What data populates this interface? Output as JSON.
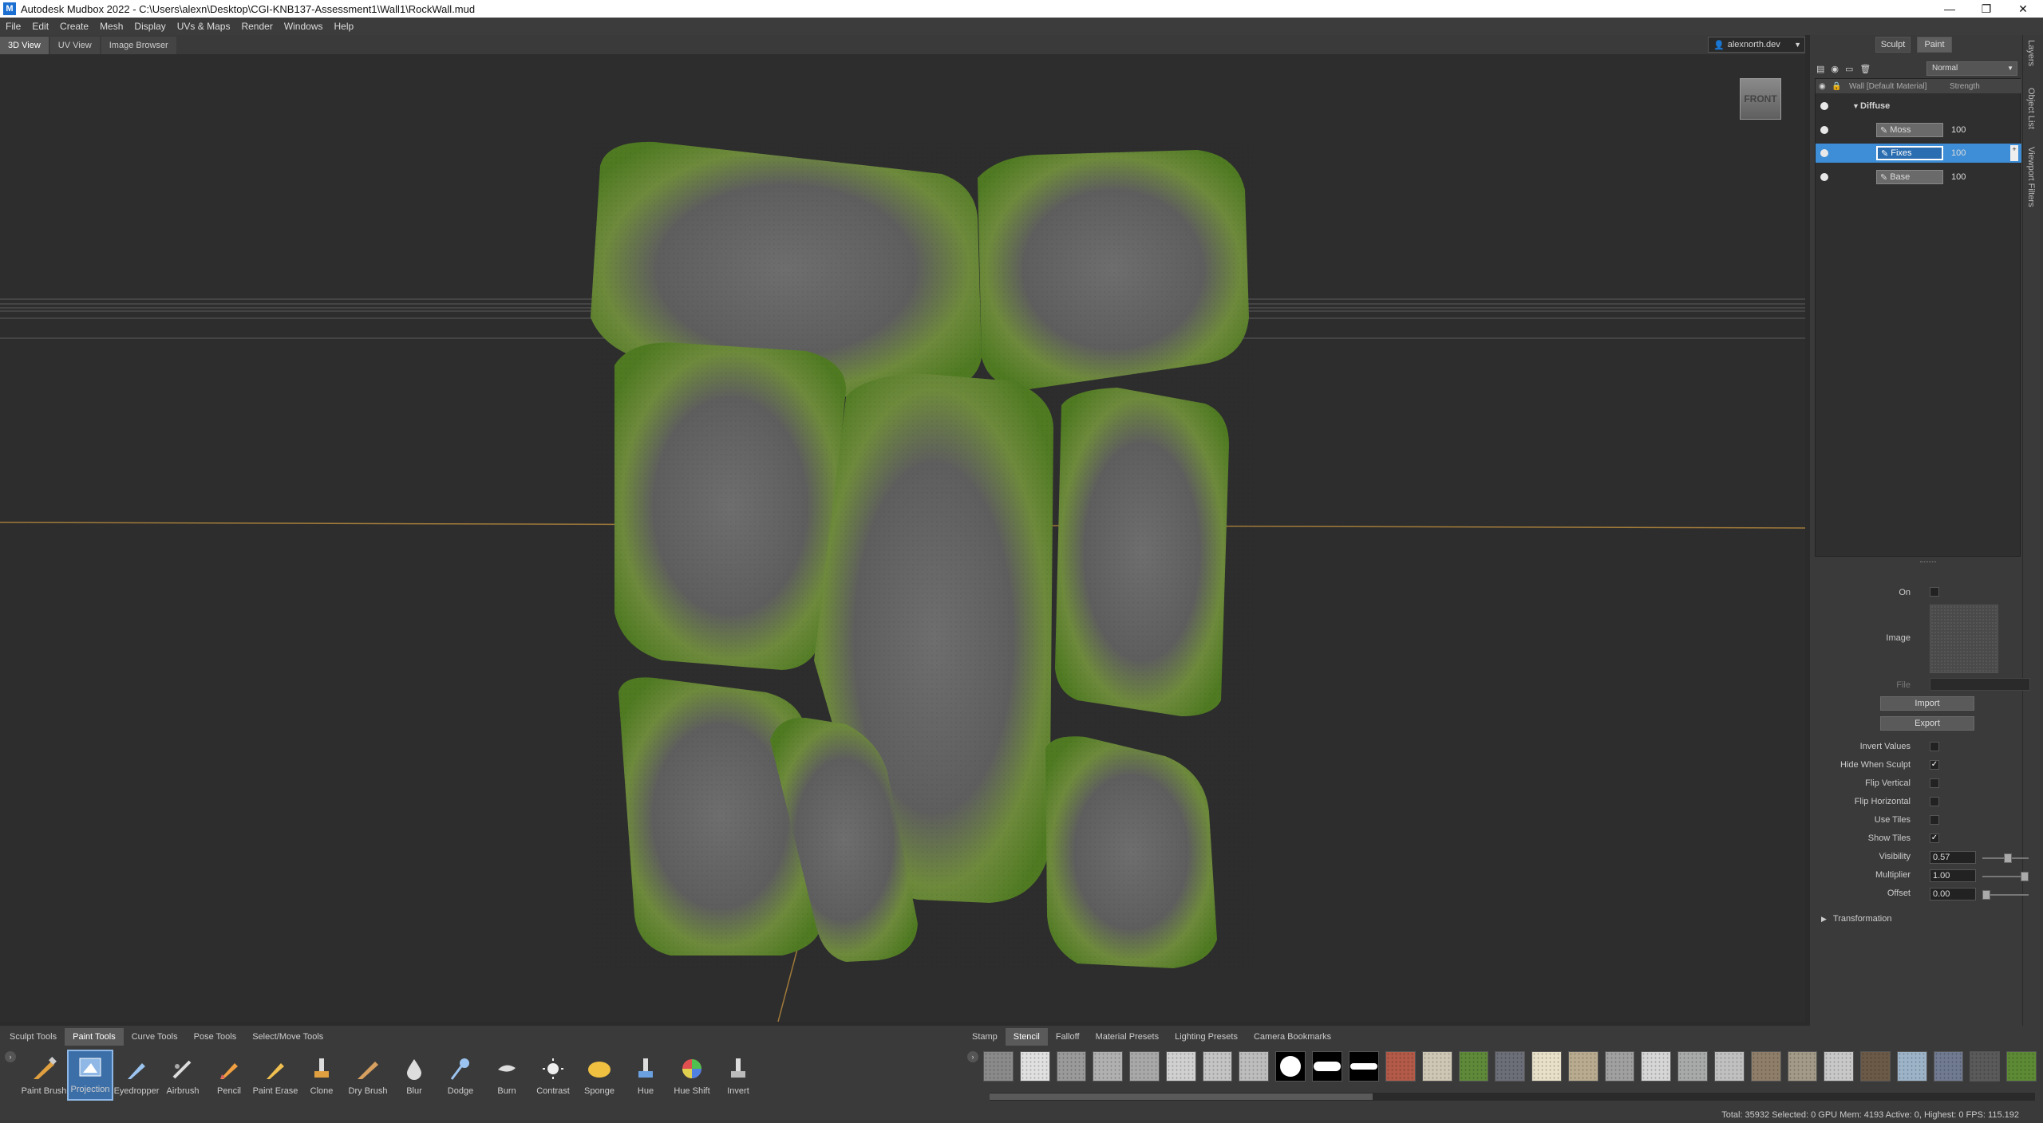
{
  "window": {
    "title": "Autodesk Mudbox 2022 - C:\\Users\\alexn\\Desktop\\CGI-KNB137-Assessment1\\Wall1\\RockWall.mud",
    "controls": [
      "minimize-icon",
      "restore-icon",
      "close-icon"
    ]
  },
  "menu": [
    "File",
    "Edit",
    "Create",
    "Mesh",
    "Display",
    "UVs & Maps",
    "Render",
    "Windows",
    "Help"
  ],
  "view_tabs": [
    {
      "label": "3D View",
      "active": true
    },
    {
      "label": "UV View",
      "active": false
    },
    {
      "label": "Image Browser",
      "active": false
    }
  ],
  "user": "alexnorth.dev",
  "viewcube_label": "FRONT",
  "mode_tabs": {
    "sculpt": "Sculpt",
    "paint": "Paint",
    "active": "Paint"
  },
  "layers": {
    "blend_mode": "Normal",
    "material_label": "Wall [Default Material]",
    "strength_header": "Strength",
    "group": "Diffuse",
    "items": [
      {
        "name": "Moss",
        "value": "100",
        "selected": false
      },
      {
        "name": "Fixes",
        "value": "100",
        "selected": true
      },
      {
        "name": "Base",
        "value": "100",
        "selected": false
      }
    ]
  },
  "side_tabs": [
    "Layers",
    "Object List",
    "Viewport Filters"
  ],
  "stencil_props": {
    "on": "On",
    "image": "Image",
    "file": "File",
    "import": "Import",
    "export": "Export",
    "invert_values": "Invert Values",
    "hide_when_sculpt": "Hide When Sculpt",
    "flip_vertical": "Flip Vertical",
    "flip_horizontal": "Flip Horizontal",
    "use_tiles": "Use Tiles",
    "show_tiles": "Show Tiles",
    "visibility_label": "Visibility",
    "visibility": "0.57",
    "visibility_level": 0.57,
    "multiplier_label": "Multiplier",
    "multiplier": "1.00",
    "multiplier_level": 1.0,
    "offset_label": "Offset",
    "offset": "0.00",
    "offset_level": 0.0,
    "transformation": "Transformation",
    "checked_mark": "✓"
  },
  "tool_tabs": [
    {
      "label": "Sculpt Tools",
      "active": false
    },
    {
      "label": "Paint Tools",
      "active": true
    },
    {
      "label": "Curve Tools",
      "active": false
    },
    {
      "label": "Pose Tools",
      "active": false
    },
    {
      "label": "Select/Move Tools",
      "active": false
    }
  ],
  "tools": [
    {
      "label": "Paint Brush",
      "icon": "paint-brush-icon"
    },
    {
      "label": "Projection",
      "icon": "projection-icon",
      "active": true
    },
    {
      "label": "Eyedropper",
      "icon": "eyedropper-icon"
    },
    {
      "label": "Airbrush",
      "icon": "airbrush-icon"
    },
    {
      "label": "Pencil",
      "icon": "pencil-icon"
    },
    {
      "label": "Paint Erase",
      "icon": "paint-erase-icon"
    },
    {
      "label": "Clone",
      "icon": "clone-icon"
    },
    {
      "label": "Dry Brush",
      "icon": "dry-brush-icon"
    },
    {
      "label": "Blur",
      "icon": "blur-icon"
    },
    {
      "label": "Dodge",
      "icon": "dodge-icon"
    },
    {
      "label": "Burn",
      "icon": "burn-icon"
    },
    {
      "label": "Contrast",
      "icon": "contrast-icon"
    },
    {
      "label": "Sponge",
      "icon": "sponge-icon"
    },
    {
      "label": "Hue",
      "icon": "hue-icon"
    },
    {
      "label": "Hue Shift",
      "icon": "hue-shift-icon"
    },
    {
      "label": "Invert",
      "icon": "invert-icon"
    }
  ],
  "tray_tabs": [
    {
      "label": "Stamp",
      "active": false
    },
    {
      "label": "Stencil",
      "active": true
    },
    {
      "label": "Falloff",
      "active": false
    },
    {
      "label": "Material Presets",
      "active": false
    },
    {
      "label": "Lighting Presets",
      "active": false
    },
    {
      "label": "Camera Bookmarks",
      "active": false
    }
  ],
  "stencil_swatches": [
    "#8a8a8a",
    "#e0e0e0",
    "#9a9a9a",
    "#b0b0b0",
    "#a8a8a8",
    "#d0d0d0",
    "#c4c4c4",
    "#bdbdbd",
    "#ffffff",
    "#ffffff",
    "#ffffff",
    "#b35a48",
    "#cfc7b5",
    "#5f8a3a",
    "#6c6e78",
    "#e8e0c8",
    "#b8ab8f",
    "#a0a0a0",
    "#d6d6d6",
    "#a7aaa8",
    "#c0c0c0",
    "#8f7f6a",
    "#a39a88",
    "#c8c8c8",
    "#6b5a47",
    "#9db4c8",
    "#707a90",
    "#5a5a5a",
    "#5d8a34"
  ],
  "status": "Total: 35932  Selected: 0  GPU Mem: 4193  Active: 0, Highest: 0  FPS: 115.192"
}
